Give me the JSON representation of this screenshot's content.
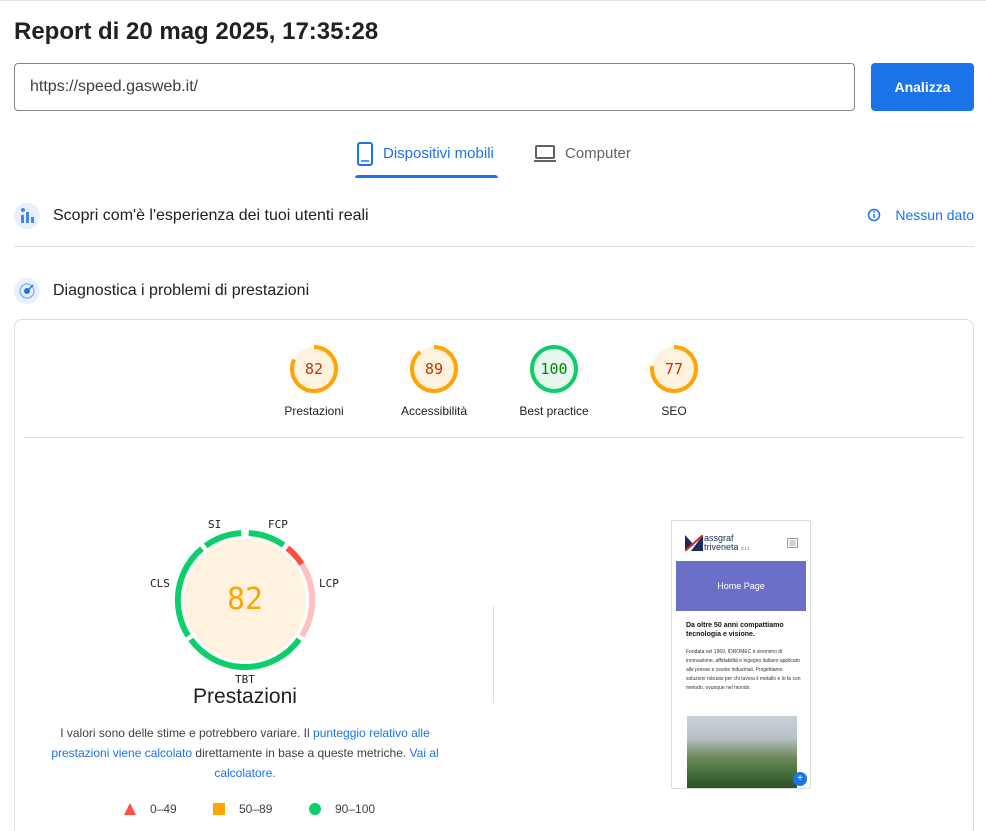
{
  "report": {
    "title": "Report di 20 mag 2025, 17:35:28"
  },
  "search": {
    "url": "https://speed.gasweb.it/",
    "analyze_label": "Analizza"
  },
  "tabs": [
    {
      "label": "Dispositivi mobili",
      "active": true
    },
    {
      "label": "Computer",
      "active": false
    }
  ],
  "field_section": {
    "title": "Scopri com'è l'esperienza dei tuoi utenti reali",
    "status": "Nessun dato"
  },
  "diagnostics": {
    "title": "Diagnostica i problemi di prestazioni"
  },
  "categories": [
    {
      "score": "82",
      "label": "Prestazioni",
      "value": 82,
      "color": "#ffa400",
      "fill": "#fff3e0",
      "text": "#c33300"
    },
    {
      "score": "89",
      "label": "Accessibilità",
      "value": 89,
      "color": "#ffa400",
      "fill": "#fff3e0",
      "text": "#c33300"
    },
    {
      "score": "100",
      "label": "Best practice",
      "value": 100,
      "color": "#0cce6b",
      "fill": "#e6f8ee",
      "text": "#008800"
    },
    {
      "score": "77",
      "label": "SEO",
      "value": 77,
      "color": "#ffa400",
      "fill": "#fff3e0",
      "text": "#c33300"
    }
  ],
  "perf_gauge": {
    "score": "82",
    "label": "Prestazioni",
    "metrics": [
      "SI",
      "FCP",
      "LCP",
      "TBT",
      "CLS"
    ]
  },
  "note": {
    "text_1": "I valori sono delle stime e potrebbero variare. Il ",
    "link_1": "punteggio relativo alle prestazioni viene calcolato",
    "text_2": " direttamente in base a queste metriche. ",
    "link_2": "Vai al calcolatore."
  },
  "legend": [
    {
      "range": "0–49",
      "shape": "triangle",
      "color": "#ff4e42"
    },
    {
      "range": "50–89",
      "shape": "square",
      "color": "#ffa400"
    },
    {
      "range": "90–100",
      "shape": "circle",
      "color": "#0cce6b"
    }
  ],
  "screenshot": {
    "logo_line_1": "assgraf",
    "logo_line_2": "triveneta",
    "logo_suffix": "s.r.l.",
    "hero": "Home Page",
    "heading": "Da oltre 50 anni compattiamo tecnologia e visione.",
    "paragraph": "Fondata nel 1969, IDROMEC è sinonimo di innovazione, affidabilità e ingegno italiano applicato alle presse e cesoie industriali. Progettiamo soluzioni robuste per chi lavora il metallo e lo fa con metodo, ovunque nel mondo."
  },
  "colors": {
    "accent": "#1a73e8",
    "pass": "#0cce6b",
    "average": "#ffa400",
    "fail": "#ff4e42"
  }
}
